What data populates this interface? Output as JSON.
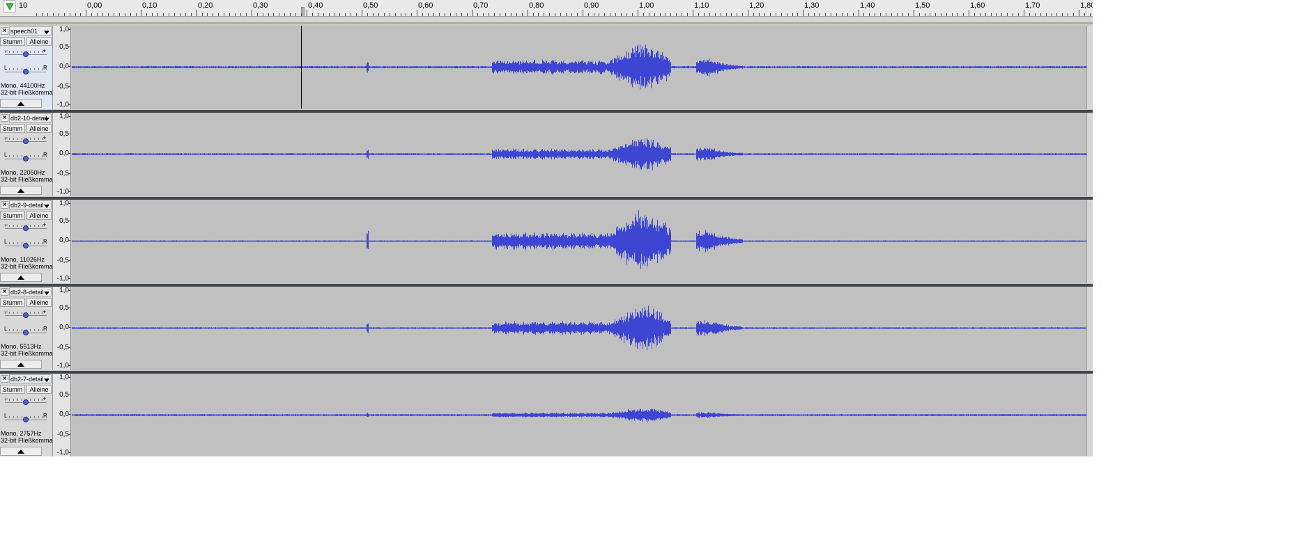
{
  "ruler": {
    "start_label": "10",
    "labels": [
      "0,00",
      "0,10",
      "0,20",
      "0,30",
      "0,40",
      "0,50",
      "0,60",
      "0,70",
      "0,80",
      "0,90",
      "1,00",
      "1,10",
      "1,20",
      "1,30",
      "1,40",
      "1,50",
      "1,60",
      "1,70",
      "1,80"
    ],
    "seconds_per_major": 0.1,
    "time_start": -0.0257,
    "time_end": 1.8137
  },
  "cursor_time": 0.39,
  "colors": {
    "waveform": "#3c46d2",
    "waveform_zero_line": "#2d38c8",
    "background": "#c0c0c0",
    "separator": "#41474f",
    "selection_marker": "#a8ac80"
  },
  "icons": {
    "play_head": "green-down-triangle-icon",
    "close": "close-x-icon",
    "menu": "dropdown-triangle-icon",
    "collapse": "collapse-up-arrow-icon"
  },
  "vertical_scale": [
    "1,0",
    "0,5",
    "0,0",
    "-0,5",
    "-1,0"
  ],
  "tracks": [
    {
      "name": "speech01",
      "mute": "Stumm",
      "solo": "Alleine",
      "gain_minus": "−",
      "gain_plus": "+",
      "pan_l": "L",
      "pan_r": "R",
      "format_line1": "Mono, 44100Hz",
      "format_line2": "32-bit Fließkomma",
      "selected": true,
      "gain": 0.5,
      "pan": 0.5,
      "noise_level": 0.012,
      "env_scale": 1.0
    },
    {
      "name": "db2-10-detail",
      "mute": "Stumm",
      "solo": "Alleine",
      "gain_minus": "−",
      "gain_plus": "+",
      "pan_l": "L",
      "pan_r": "R",
      "format_line1": "Mono, 22050Hz",
      "format_line2": "32-bit Fließkomma",
      "selected": false,
      "gain": 0.5,
      "pan": 0.5,
      "noise_level": 0.01,
      "env_scale": 0.75
    },
    {
      "name": "db2-9-detail",
      "mute": "Stumm",
      "solo": "Alleine",
      "gain_minus": "−",
      "gain_plus": "+",
      "pan_l": "L",
      "pan_r": "R",
      "format_line1": "Mono, 11026Hz",
      "format_line2": "32-bit Fließkomma",
      "selected": false,
      "gain": 0.5,
      "pan": 0.5,
      "noise_level": 0.006,
      "env_scale": 1.3
    },
    {
      "name": "db2-8-detail",
      "mute": "Stumm",
      "solo": "Alleine",
      "gain_minus": "−",
      "gain_plus": "+",
      "pan_l": "L",
      "pan_r": "R",
      "format_line1": "Mono, 5513Hz",
      "format_line2": "32-bit Fließkomma",
      "selected": false,
      "gain": 0.5,
      "pan": 0.5,
      "noise_level": 0.008,
      "env_scale": 0.95
    },
    {
      "name": "db2-7-detail",
      "mute": "Stumm",
      "solo": "Alleine",
      "gain_minus": "−",
      "gain_plus": "+",
      "pan_l": "L",
      "pan_r": "R",
      "format_line1": "Mono, 2757Hz",
      "format_line2": "32-bit Fließkomma",
      "selected": false,
      "gain": 0.5,
      "pan": 0.5,
      "noise_level": 0.01,
      "env_scale": 0.3
    }
  ]
}
